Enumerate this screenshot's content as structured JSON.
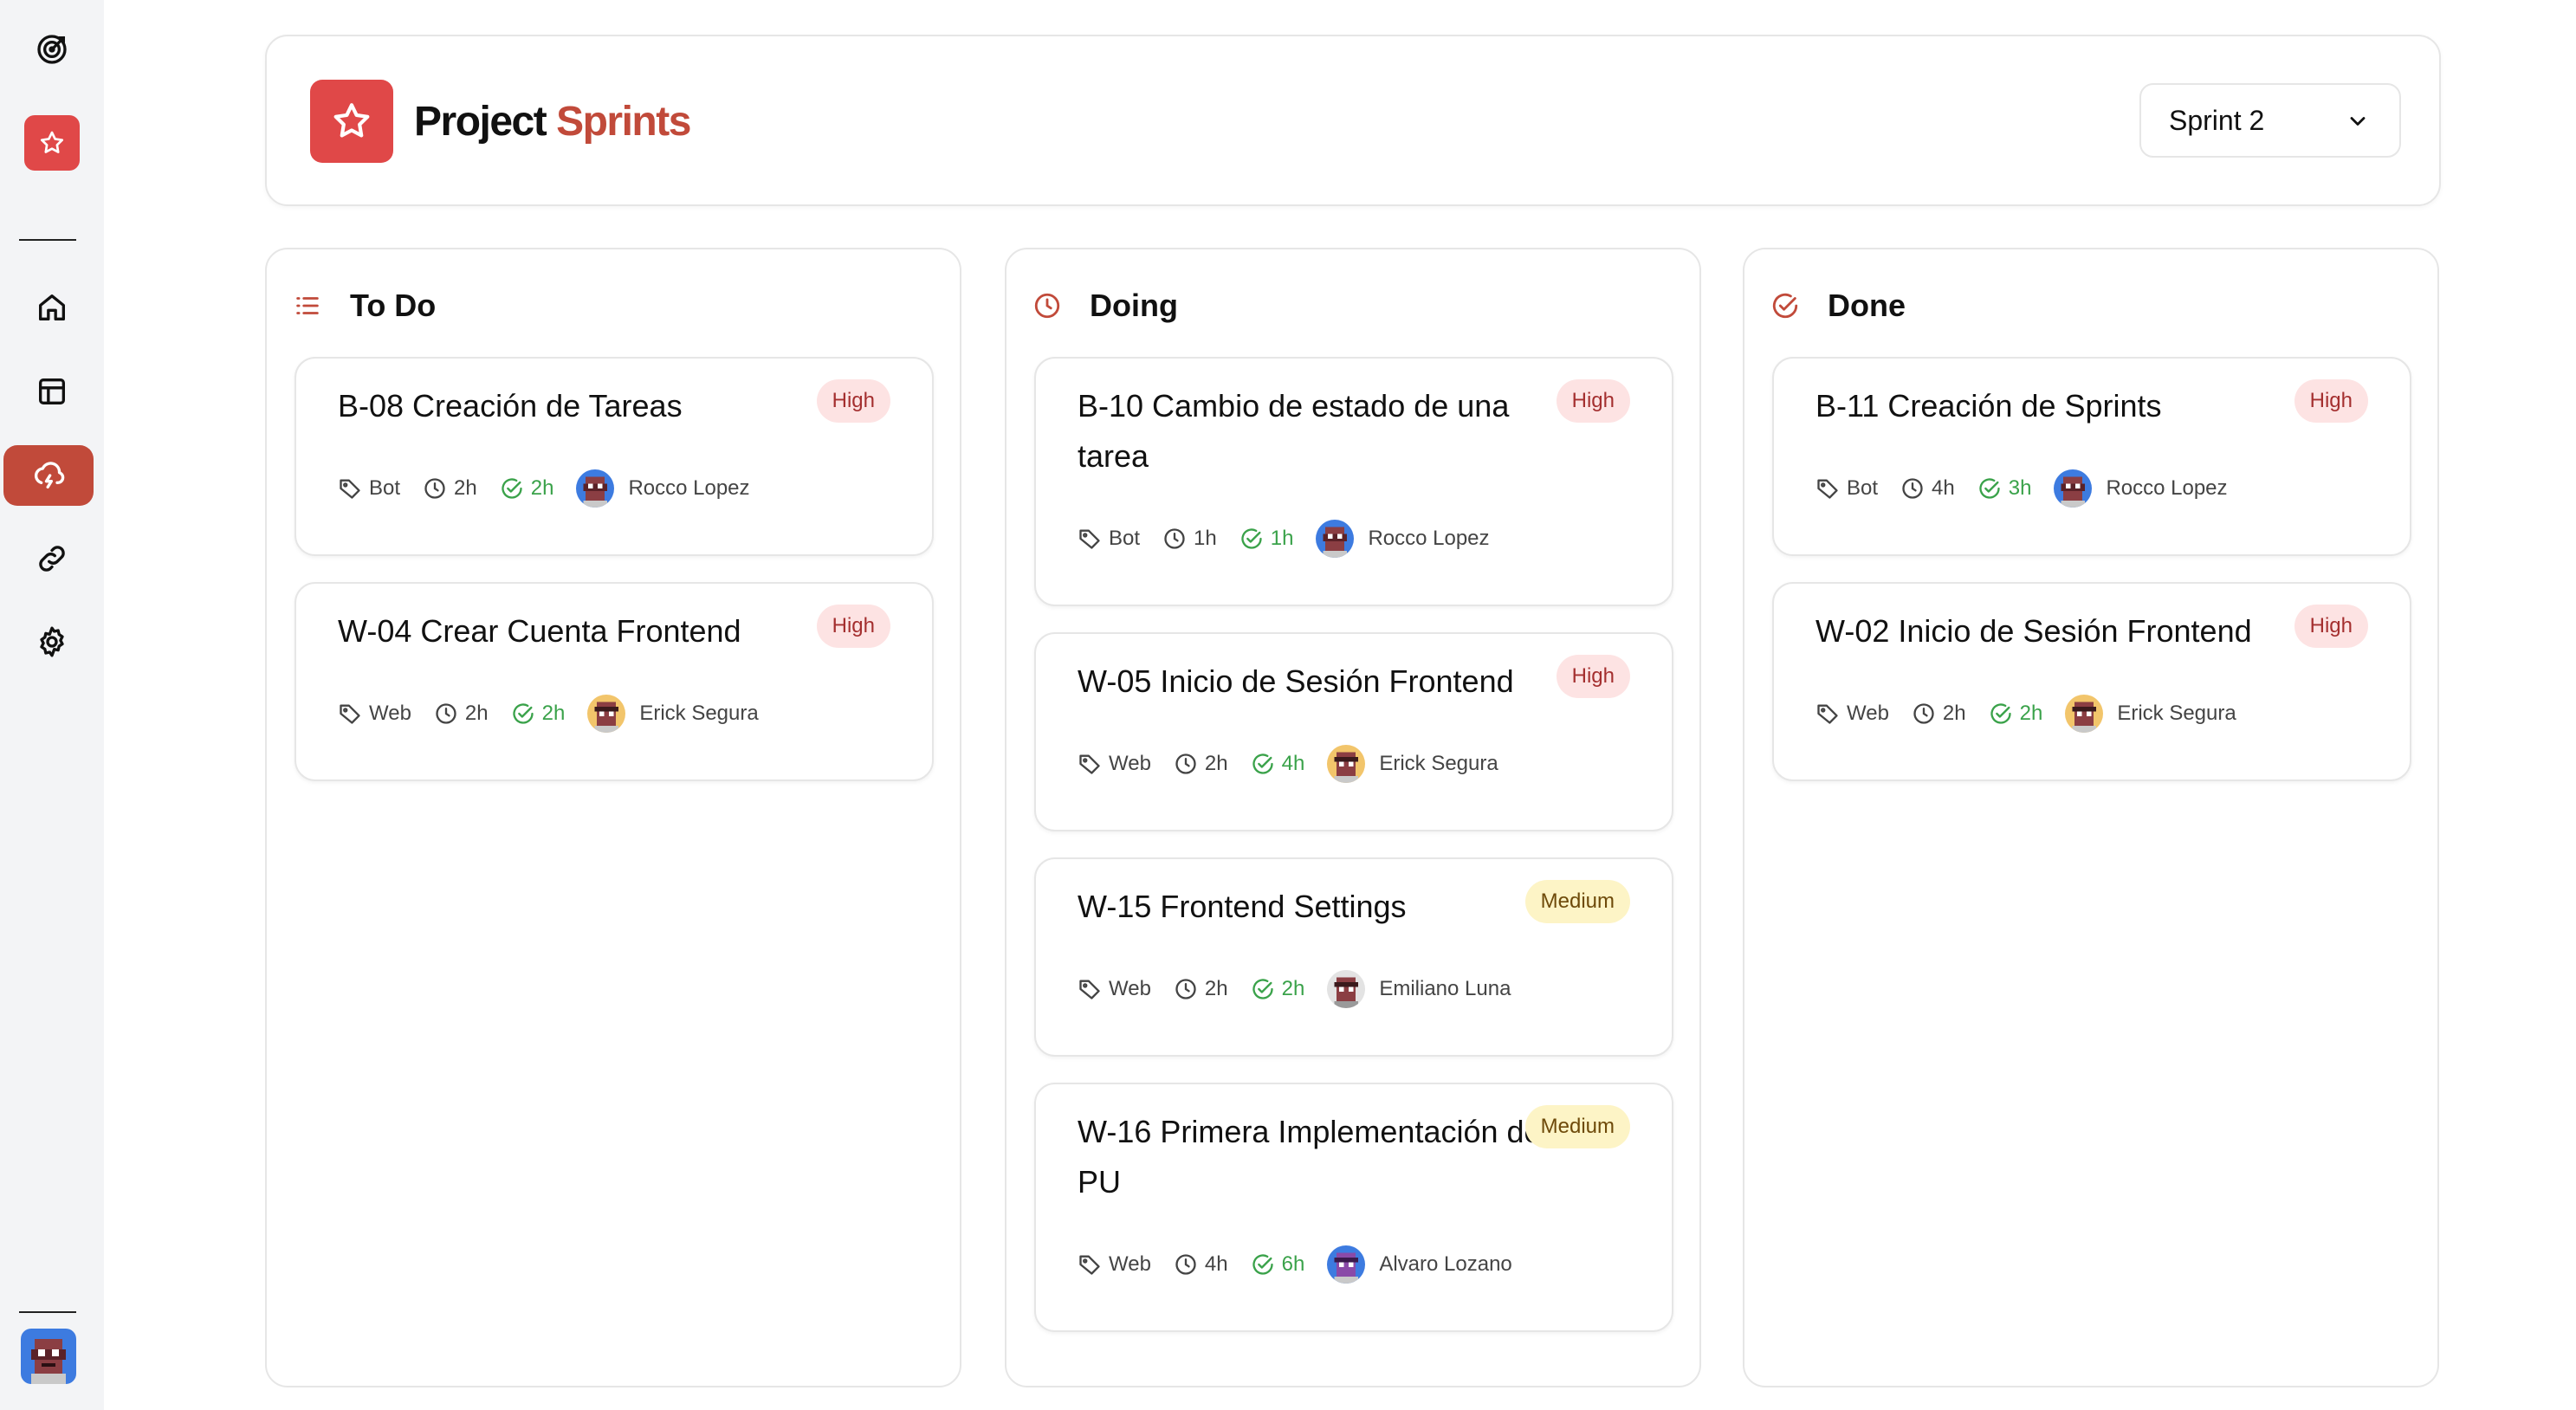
{
  "header": {
    "title_part1": "Project",
    "title_part2": "Sprints",
    "sprint_selected": "Sprint 2"
  },
  "columns": [
    {
      "title": "To Do",
      "icon": "list-icon",
      "cards": [
        {
          "title": "B-08 Creación de Tareas",
          "priority": "High",
          "tag": "Bot",
          "estimate": "2h",
          "actual": "2h",
          "user": "Rocco Lopez"
        },
        {
          "title": "W-04 Crear Cuenta Frontend",
          "priority": "High",
          "tag": "Web",
          "estimate": "2h",
          "actual": "2h",
          "user": "Erick Segura"
        }
      ]
    },
    {
      "title": "Doing",
      "icon": "clock-icon",
      "cards": [
        {
          "title": "B-10 Cambio de estado de una tarea",
          "priority": "High",
          "tag": "Bot",
          "estimate": "1h",
          "actual": "1h",
          "user": "Rocco Lopez"
        },
        {
          "title": "W-05 Inicio de Sesión Frontend",
          "priority": "High",
          "tag": "Web",
          "estimate": "2h",
          "actual": "4h",
          "user": "Erick Segura"
        },
        {
          "title": "W-15 Frontend Settings",
          "priority": "Medium",
          "tag": "Web",
          "estimate": "2h",
          "actual": "2h",
          "user": "Emiliano Luna"
        },
        {
          "title": "W-16 Primera Implementación de PU",
          "priority": "Medium",
          "tag": "Web",
          "estimate": "4h",
          "actual": "6h",
          "user": "Alvaro Lozano"
        }
      ]
    },
    {
      "title": "Done",
      "icon": "check-circle-icon",
      "cards": [
        {
          "title": "B-11 Creación de Sprints",
          "priority": "High",
          "tag": "Bot",
          "estimate": "4h",
          "actual": "3h",
          "user": "Rocco Lopez"
        },
        {
          "title": "W-02 Inicio de Sesión Frontend",
          "priority": "High",
          "tag": "Web",
          "estimate": "2h",
          "actual": "2h",
          "user": "Erick Segura"
        }
      ]
    }
  ],
  "colors": {
    "accent": "#c14a3a",
    "brand_red": "#e04848",
    "high_bg": "#fde3e3",
    "medium_bg": "#fdf4c6",
    "actual_green": "#3aa24a"
  }
}
